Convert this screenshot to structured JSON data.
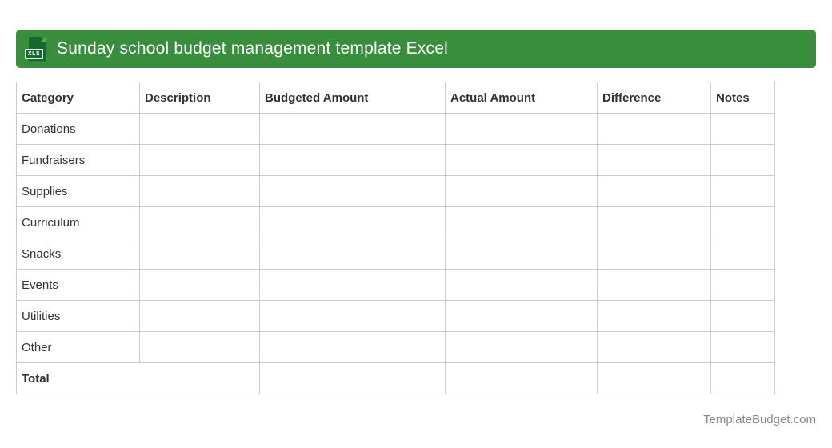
{
  "header": {
    "title": "Sunday school budget management template Excel",
    "file_badge": "XLS"
  },
  "table": {
    "columns": [
      "Category",
      "Description",
      "Budgeted Amount",
      "Actual Amount",
      "Difference",
      "Notes"
    ],
    "rows": [
      "Donations",
      "Fundraisers",
      "Supplies",
      "Curriculum",
      "Snacks",
      "Events",
      "Utilities",
      "Other"
    ],
    "total_label": "Total"
  },
  "footer": {
    "watermark": "TemplateBudget.com"
  },
  "colors": {
    "header_bar": "#388e3c",
    "icon_document": "#17682e",
    "icon_fold": "#4caf50",
    "table_border": "#cccccc",
    "text": "#333333",
    "footer_text": "#878787"
  }
}
